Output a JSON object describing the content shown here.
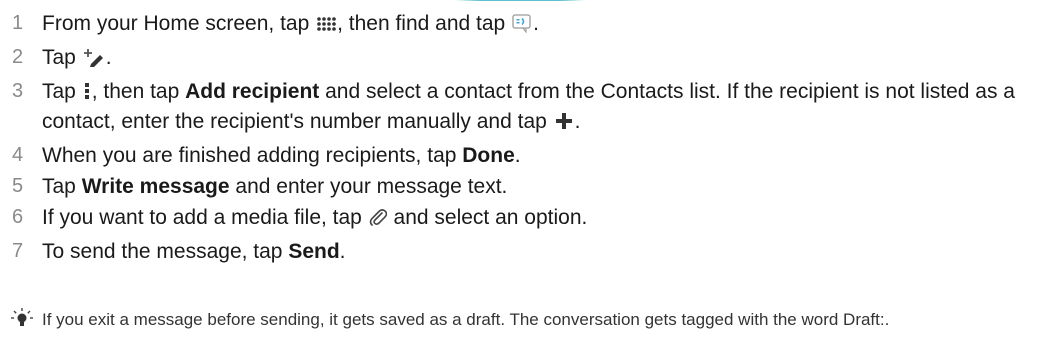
{
  "steps": [
    {
      "number": "1",
      "t1": "From your Home screen, tap ",
      "t2": ", then find and tap ",
      "t3": ".",
      "icons": [
        "apps-grid-icon",
        "messaging-app-icon"
      ]
    },
    {
      "number": "2",
      "t1": "Tap ",
      "t2": ".",
      "icons": [
        "compose-new-message-icon"
      ]
    },
    {
      "number": "3",
      "t1": "Tap ",
      "t2": ", then tap ",
      "b1": "Add recipient",
      "t3": " and select a contact from the Contacts list. If the recipient is not listed as a contact, enter the recipient's number manually and tap ",
      "t4": ".",
      "icons": [
        "more-options-icon",
        "plus-icon"
      ]
    },
    {
      "number": "4",
      "t1": "When you are finished adding recipients, tap ",
      "b1": "Done",
      "t2": "."
    },
    {
      "number": "5",
      "t1": "Tap ",
      "b1": "Write message",
      "t2": " and enter your message text."
    },
    {
      "number": "6",
      "t1": "If you want to add a media file, tap ",
      "t2": " and select an option.",
      "icons": [
        "attachment-paperclip-icon"
      ]
    },
    {
      "number": "7",
      "t1": "To send the message, tap ",
      "b1": "Send",
      "t2": "."
    }
  ],
  "tip": {
    "icon": "tip-lightbulb-icon",
    "text": "If you exit a message before sending, it gets saved as a draft. The conversation gets tagged with the word Draft:."
  },
  "colors": {
    "text": "#1a1a1a",
    "step_number": "#8a8a8a",
    "accent": "#3fb4c9"
  }
}
